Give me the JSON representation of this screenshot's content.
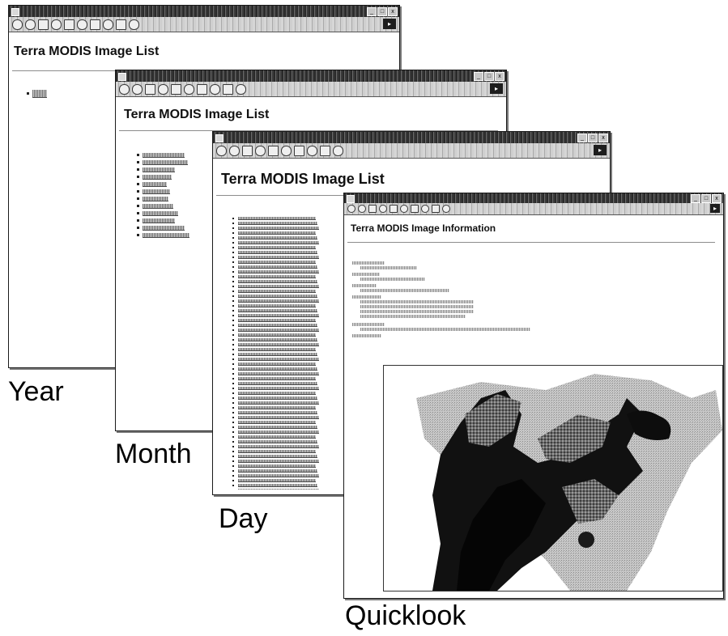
{
  "windows": [
    {
      "id": "year",
      "page_title": "Terra MODIS Image List",
      "caption": "Year"
    },
    {
      "id": "month",
      "page_title": "Terra MODIS Image List",
      "caption": "Month"
    },
    {
      "id": "day",
      "page_title": "Terra MODIS Image List",
      "caption": "Day"
    },
    {
      "id": "quicklook",
      "page_title": "Terra MODIS Image Information",
      "caption": "Quicklook"
    }
  ],
  "icons": {
    "nav_back": "arrow-left-icon",
    "nav_forward": "arrow-right-icon",
    "stop": "stop-icon",
    "refresh": "refresh-icon",
    "home": "home-icon",
    "search": "search-icon",
    "favorites": "favorites-icon",
    "history": "history-icon",
    "go": "go-icon"
  },
  "colors": {
    "titlebar": "#2a2a2a",
    "toolbar": "#cfcfcf",
    "link": "#6f6f6f",
    "map_dark": "#0d0d0d",
    "map_mid": "#7a7a7a",
    "map_light": "#e0e0e0"
  },
  "lists": {
    "year_item_count": 1,
    "month_item_count": 12,
    "day_item_count": 62
  }
}
